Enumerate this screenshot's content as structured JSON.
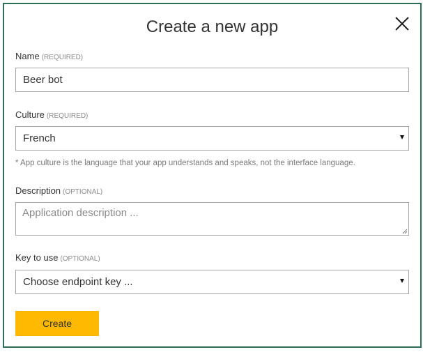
{
  "dialog": {
    "title": "Create a new app",
    "close_icon": "close-icon"
  },
  "fields": {
    "name": {
      "label": "Name",
      "tag": "(REQUIRED)",
      "value": "Beer bot"
    },
    "culture": {
      "label": "Culture",
      "tag": "(REQUIRED)",
      "selected": "French",
      "note": "* App culture is the language that your app understands and speaks, not the interface language."
    },
    "description": {
      "label": "Description",
      "tag": "(OPTIONAL)",
      "placeholder": "Application description ..."
    },
    "key": {
      "label": "Key to use",
      "tag": "(OPTIONAL)",
      "selected": "Choose endpoint key ..."
    }
  },
  "actions": {
    "create_label": "Create"
  },
  "colors": {
    "accent": "#ffb900",
    "border": "#2e6e55"
  }
}
